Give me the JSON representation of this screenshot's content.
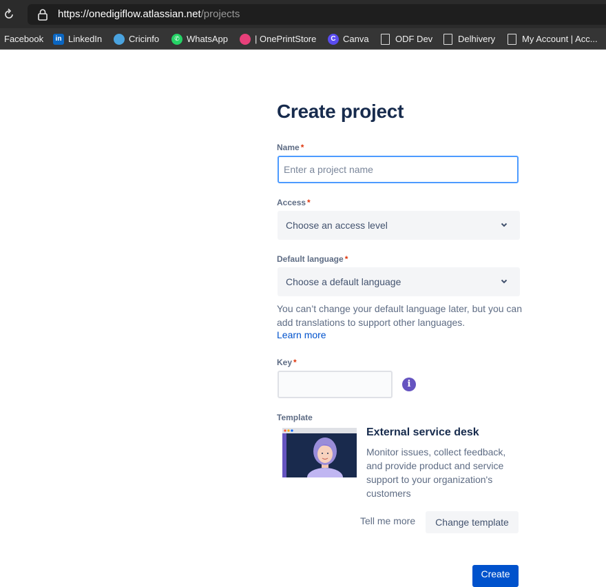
{
  "browser": {
    "url_main": "https://onedigiflow.atlassian.net",
    "url_path": "/projects",
    "bookmarks": [
      {
        "label": "Facebook",
        "icon": "none"
      },
      {
        "label": "LinkedIn",
        "icon": "linkedin-icon"
      },
      {
        "label": "Cricinfo",
        "icon": "cricinfo-icon"
      },
      {
        "label": "WhatsApp",
        "icon": "whatsapp-icon"
      },
      {
        "label": "| OnePrintStore",
        "icon": "oneprintstore-icon"
      },
      {
        "label": "Canva",
        "icon": "canva-icon"
      },
      {
        "label": "ODF Dev",
        "icon": "document-icon"
      },
      {
        "label": "Delhivery",
        "icon": "document-icon"
      },
      {
        "label": "My Account | Acc...",
        "icon": "document-icon"
      }
    ]
  },
  "form": {
    "title": "Create project",
    "name": {
      "label": "Name",
      "required": "*",
      "placeholder": "Enter a project name",
      "value": ""
    },
    "access": {
      "label": "Access",
      "required": "*",
      "selected": "Choose an access level"
    },
    "language": {
      "label": "Default language",
      "required": "*",
      "selected": "Choose a default language"
    },
    "language_helper": "You can’t change your default language later, but you can add translations to support other languages.",
    "learn_more": "Learn more",
    "key": {
      "label": "Key",
      "required": "*",
      "value": ""
    },
    "template": {
      "label": "Template",
      "title": "External service desk",
      "description": "Monitor issues, collect feedback, and provide product and service support to your organization's customers",
      "tell_more": "Tell me more",
      "change": "Change template"
    },
    "create": "Create"
  },
  "colors": {
    "primary": "#0052cc",
    "required": "#de350b",
    "info": "#6554c0",
    "focus_border": "#4c9aff"
  }
}
